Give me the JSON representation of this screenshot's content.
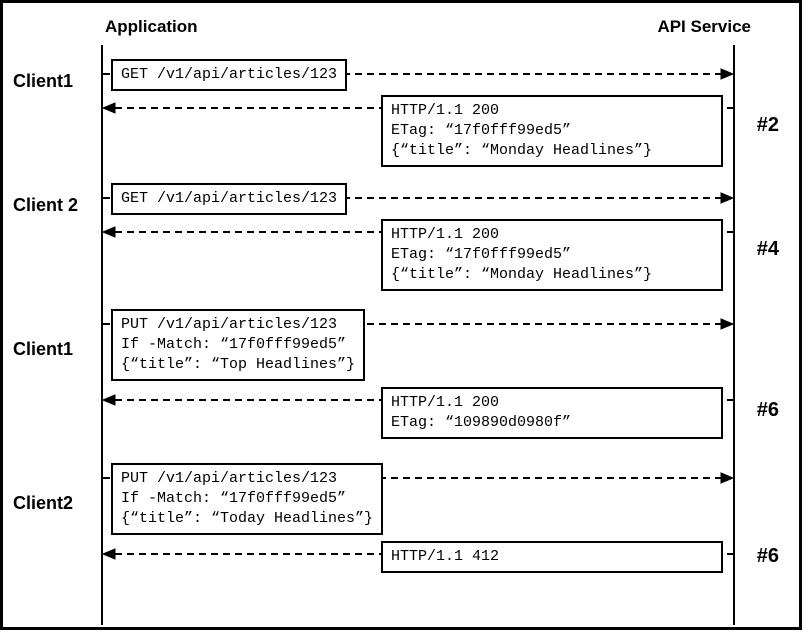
{
  "header": {
    "left": "Application",
    "right": "API Service"
  },
  "exchanges": [
    {
      "id": "ex1",
      "client": "Client1",
      "request_lines": "GET /v1/api/articles/123",
      "response_lines": "HTTP/1.1 200\nETag: “17f0fff99ed5”\n{“title”: “Monday Headlines”}",
      "step": "#2"
    },
    {
      "id": "ex2",
      "client": "Client 2",
      "request_lines": "GET /v1/api/articles/123",
      "response_lines": "HTTP/1.1 200\nETag: “17f0fff99ed5”\n{“title”: “Monday Headlines”}",
      "step": "#4"
    },
    {
      "id": "ex3",
      "client": "Client1",
      "request_lines": "PUT /v1/api/articles/123\nIf -Match: “17f0fff99ed5”\n{“title”: “Top Headlines”}",
      "response_lines": "HTTP/1.1 200\nETag: “109890d0980f”",
      "step": "#6"
    },
    {
      "id": "ex4",
      "client": "Client2",
      "request_lines": "PUT /v1/api/articles/123\nIf -Match: “17f0fff99ed5”\n{“title”: “Today Headlines”}",
      "response_lines": "HTTP/1.1 412",
      "step": "#6"
    }
  ]
}
